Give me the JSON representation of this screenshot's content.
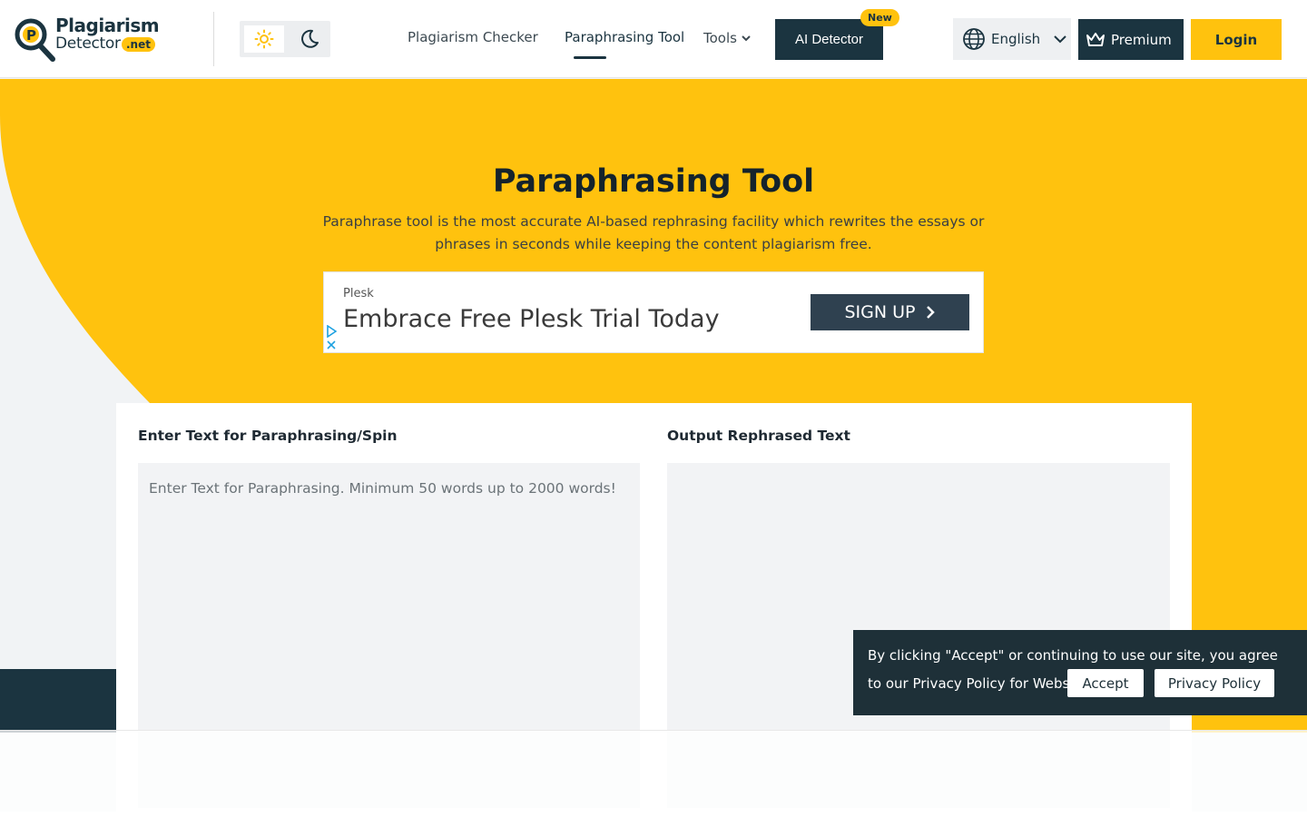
{
  "header": {
    "logo": {
      "line1": "Plagiarism",
      "line2": "Detector",
      "tld": ".net"
    },
    "nav": [
      {
        "label": "Plagiarism Checker"
      },
      {
        "label": "Paraphrasing Tool"
      }
    ],
    "tools_label": "Tools",
    "ai_detector_label": "AI Detector",
    "new_badge": "New",
    "language": "English",
    "premium_label": "Premium",
    "login_label": "Login"
  },
  "hero": {
    "title": "Paraphrasing Tool",
    "subtitle": "Paraphrase tool is the most accurate AI-based rephrasing facility which rewrites the essays or phrases in seconds while keeping the content plagiarism free."
  },
  "ad": {
    "brand": "Plesk",
    "headline": "Embrace Free Plesk Trial Today",
    "cta": "SIGN UP"
  },
  "editor": {
    "input_label": "Enter Text for Paraphrasing/Spin",
    "input_placeholder": "Enter Text for Paraphrasing. Minimum 50 words up to 2000 words!",
    "input_value": "",
    "output_label": "Output Rephrased Text",
    "output_value": ""
  },
  "cookie": {
    "text": "By clicking \"Accept\" or continuing to use our site, you agree to our Privacy Policy for Website",
    "accept_label": "Accept",
    "privacy_label": "Privacy Policy"
  },
  "colors": {
    "brand_yellow": "#ffc20e",
    "brand_dark": "#1b3440"
  },
  "icons": {
    "sun": "sun-icon",
    "moon": "moon-icon",
    "globe": "globe-icon",
    "crown": "crown-icon"
  }
}
